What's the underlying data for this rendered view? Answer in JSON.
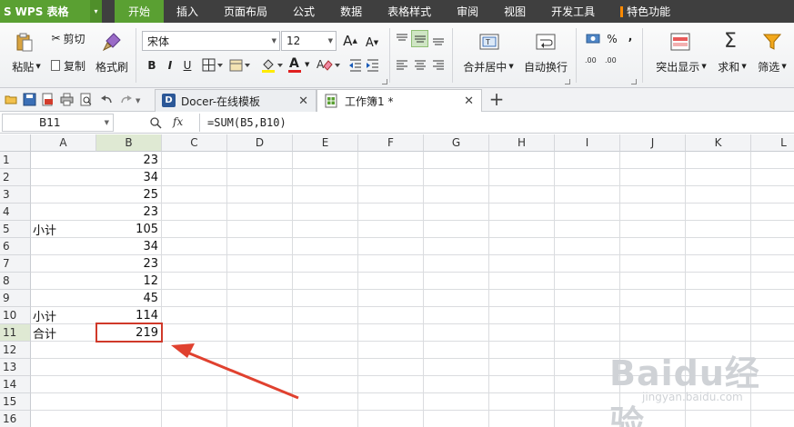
{
  "app": {
    "logo_text": "S",
    "name": "WPS 表格",
    "dropdown": "▾"
  },
  "menu": {
    "items": [
      "开始",
      "插入",
      "页面布局",
      "公式",
      "数据",
      "表格样式",
      "审阅",
      "视图",
      "开发工具",
      "特色功能"
    ],
    "active_index": 0
  },
  "ribbon": {
    "paste_label": "粘贴",
    "cut_label": "剪切",
    "copy_label": "复制",
    "format_painter_label": "格式刷",
    "font_name": "宋体",
    "font_size": "12",
    "grow_label": "A",
    "shrink_label": "A",
    "bold": "B",
    "italic": "I",
    "underline": "U",
    "font_color_label": "A",
    "merge_label": "合并居中",
    "wrap_label": "自动换行",
    "percent_label": "%",
    "comma_label": ",",
    "dec_inc_label": ".00",
    "dec_dec_label": ".00",
    "highlight_label": "突出显示",
    "sum_label": "求和",
    "filter_label": "筛选",
    "sigma": "Σ"
  },
  "tabs": [
    {
      "label": "Docer-在线模板",
      "active": false
    },
    {
      "label": "工作簿1 *",
      "active": true
    }
  ],
  "add_tab": "+",
  "formula_bar": {
    "name_box": "B11",
    "fx": "fx",
    "formula": "=SUM(B5,B10)"
  },
  "columns": [
    "A",
    "B",
    "C",
    "D",
    "E",
    "F",
    "G",
    "H",
    "I",
    "J",
    "K",
    "L"
  ],
  "selected_column": "B",
  "rows": [
    "1",
    "2",
    "3",
    "4",
    "5",
    "6",
    "7",
    "8",
    "9",
    "10",
    "11",
    "12",
    "13",
    "14",
    "15",
    "16"
  ],
  "selected_row": "11",
  "cells": {
    "A5": "小计",
    "A10": "小计",
    "A11": "合计",
    "B1": "23",
    "B2": "34",
    "B3": "25",
    "B4": "23",
    "B5": "105",
    "B6": "34",
    "B7": "23",
    "B8": "12",
    "B9": "45",
    "B10": "114",
    "B11": "219"
  },
  "watermark": {
    "brand": "Baidu经验",
    "url": "jingyan.baidu.com"
  },
  "colors": {
    "menu_bg": "#3f3f3f",
    "accent": "#5aa032",
    "selection_border": "#d0392a",
    "arrow": "#e0412f"
  }
}
